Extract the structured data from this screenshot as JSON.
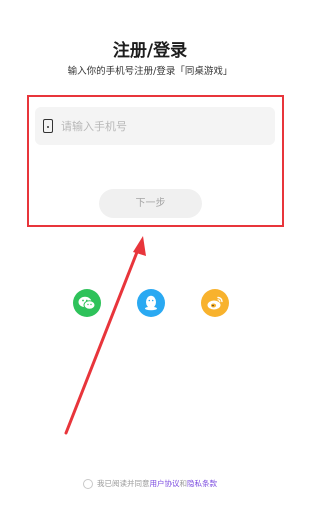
{
  "header": {
    "title": "注册/登录",
    "subtitle": "输入你的手机号注册/登录「同桌游戏」"
  },
  "form": {
    "phone_placeholder": "请输入手机号",
    "phone_value": "",
    "next_label": "下一步"
  },
  "social": [
    {
      "name": "wechat",
      "icon": "wechat-icon",
      "color": "#2ec25a"
    },
    {
      "name": "qq",
      "icon": "qq-icon",
      "color": "#2aa9f2"
    },
    {
      "name": "weibo",
      "icon": "weibo-icon",
      "color": "#f8b22d"
    }
  ],
  "agreement": {
    "prefix": "我已阅读并同意",
    "user_agreement": "用户协议",
    "and": "和",
    "privacy": "隐私条款"
  },
  "annotation": {
    "box_color": "#e8353b",
    "arrow_color": "#e8353b"
  }
}
